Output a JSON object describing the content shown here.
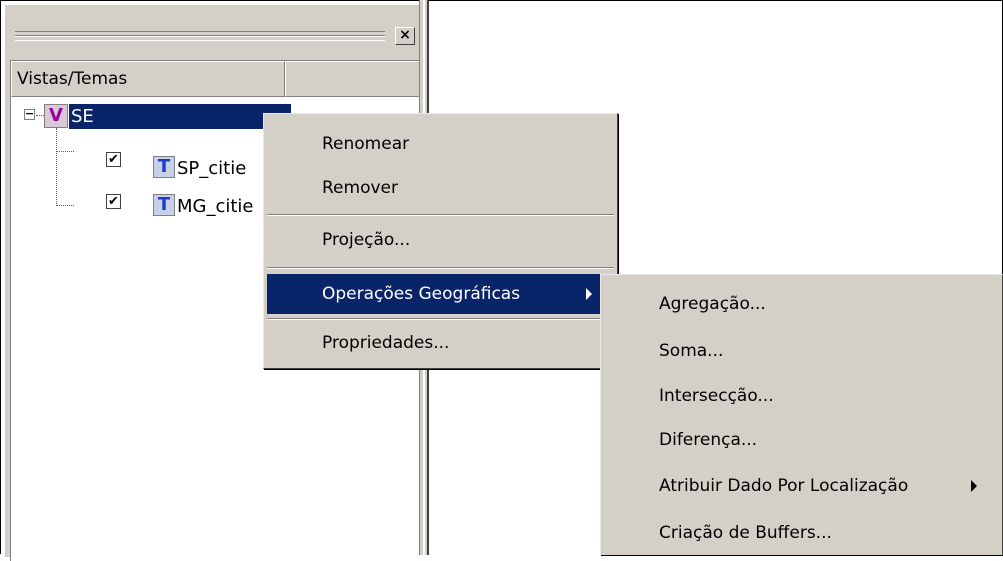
{
  "panel": {
    "close_label": "×",
    "columns": [
      "Vistas/Temas",
      ""
    ]
  },
  "tree": {
    "view": {
      "icon": "V",
      "label": "SE",
      "expander": "−"
    },
    "themes": [
      {
        "icon": "T",
        "label": "SP_citie",
        "checked": "✔"
      },
      {
        "icon": "T",
        "label": "MG_citie",
        "checked": "✔"
      }
    ]
  },
  "context_menu": {
    "items": [
      "Renomear",
      "Remover",
      "Projeção...",
      "Operações Geográficas",
      "Propriedades..."
    ]
  },
  "submenu": {
    "items": [
      "Agregação...",
      "Soma...",
      "Intersecção...",
      "Diferença...",
      "Atribuir Dado Por Localização",
      "Criação de Buffers..."
    ]
  },
  "colors": {
    "selection": "#0a246a",
    "face": "#d4d0c8",
    "view_icon": "#9b009b",
    "theme_icon": "#1a3cc8"
  }
}
